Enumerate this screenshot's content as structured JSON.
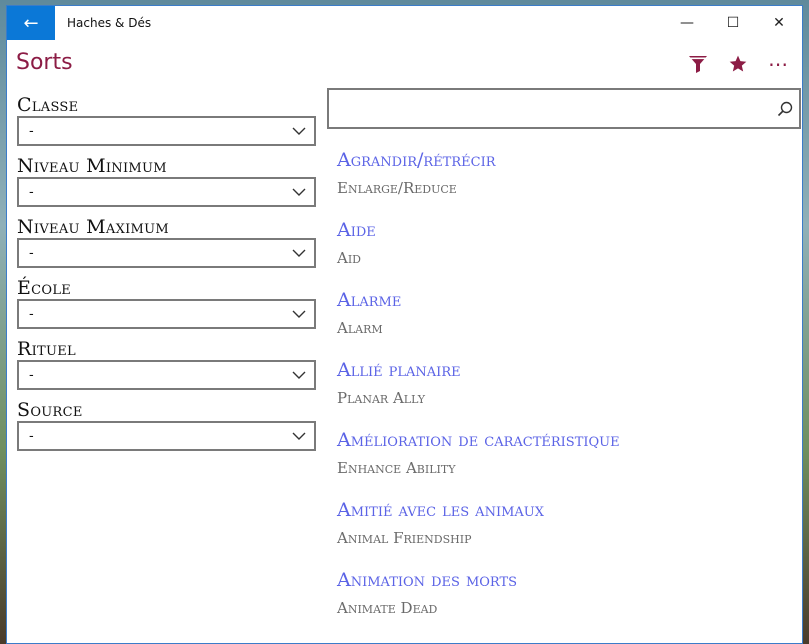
{
  "app": {
    "title": "Haches & Dés"
  },
  "titlebar": {
    "back_icon": "←",
    "minimize_icon": "—",
    "maximize_icon": "☐",
    "close_icon": "✕"
  },
  "page": {
    "title": "Sorts"
  },
  "commands": {
    "filter_icon": "funnel-icon",
    "favorites_icon": "star-icon",
    "more_icon": "⋯"
  },
  "filters": [
    {
      "label": "Classe",
      "value": "-"
    },
    {
      "label": "Niveau Minimum",
      "value": "-"
    },
    {
      "label": "Niveau Maximum",
      "value": "-"
    },
    {
      "label": "École",
      "value": "-"
    },
    {
      "label": "Rituel",
      "value": "-"
    },
    {
      "label": "Source",
      "value": "-"
    }
  ],
  "search": {
    "value": "",
    "placeholder": ""
  },
  "spells": [
    {
      "name": "Agrandir/rétrécir",
      "english": "Enlarge/Reduce"
    },
    {
      "name": "Aide",
      "english": "Aid"
    },
    {
      "name": "Alarme",
      "english": "Alarm"
    },
    {
      "name": "Allié planaire",
      "english": "Planar Ally"
    },
    {
      "name": "Amélioration de caractéristique",
      "english": "Enhance Ability"
    },
    {
      "name": "Amitié avec les animaux",
      "english": "Animal Friendship"
    },
    {
      "name": "Animation des morts",
      "english": "Animate Dead"
    }
  ],
  "colors": {
    "accent": "#8c1c45",
    "link": "#5b63e6",
    "title_back": "#0b78d7"
  }
}
